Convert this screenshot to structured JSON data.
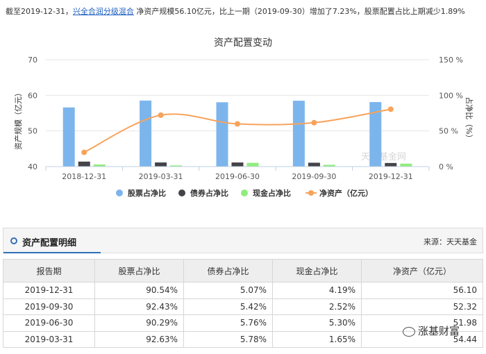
{
  "summary": {
    "prefix": "截至2019-12-31，",
    "fund_name": "兴全合润分级混合",
    "text": " 净资产规模56.10亿元，比上一期（2019-09-30）增加了7.23%，股票配置占比上期减少1.89%"
  },
  "chart_data": {
    "type": "bar",
    "title": "资产配置变动",
    "categories": [
      "2018-12-31",
      "2019-03-31",
      "2019-06-30",
      "2019-09-30",
      "2019-12-31"
    ],
    "ylabel_left": "资产规模（亿元）",
    "ylabel_right": "占净比（%）",
    "ylim_left": [
      40,
      70
    ],
    "yticks_left": [
      "40",
      "50",
      "60",
      "70"
    ],
    "ylim_right": [
      0,
      150
    ],
    "yticks_right": [
      "0 %",
      "50 %",
      "100 %",
      "150 %"
    ],
    "grid": true,
    "legend_position": "bottom",
    "series": [
      {
        "name": "股票占净比",
        "axis": "right",
        "kind": "bar",
        "color": "#7cb5ec",
        "values": [
          83,
          92.63,
          90.29,
          92.43,
          90.54
        ]
      },
      {
        "name": "债券占净比",
        "axis": "right",
        "kind": "bar",
        "color": "#434348",
        "values": [
          7,
          5.78,
          5.76,
          5.42,
          5.07
        ]
      },
      {
        "name": "现金占净比",
        "axis": "right",
        "kind": "bar",
        "color": "#90ed7d",
        "values": [
          3,
          1.65,
          5.3,
          2.52,
          4.19
        ]
      },
      {
        "name": "净资产（亿元）",
        "axis": "left",
        "kind": "line",
        "color": "#f7a35c",
        "values": [
          44.0,
          54.44,
          51.98,
          52.32,
          56.1
        ]
      }
    ]
  },
  "watermark_chart": "天天基金网",
  "detail": {
    "title": "资产配置明细",
    "source": "来源：天天基金",
    "columns": [
      "报告期",
      "股票占净比",
      "债券占净比",
      "现金占净比",
      "净资产（亿元）"
    ],
    "rows": [
      [
        "2019-12-31",
        "90.54%",
        "5.07%",
        "4.19%",
        "56.10"
      ],
      [
        "2019-09-30",
        "92.43%",
        "5.42%",
        "2.52%",
        "52.32"
      ],
      [
        "2019-06-30",
        "90.29%",
        "5.76%",
        "5.30%",
        "51.98"
      ],
      [
        "2019-03-31",
        "92.63%",
        "5.78%",
        "1.65%",
        "54.44"
      ]
    ]
  },
  "watermark": "涨基财富"
}
